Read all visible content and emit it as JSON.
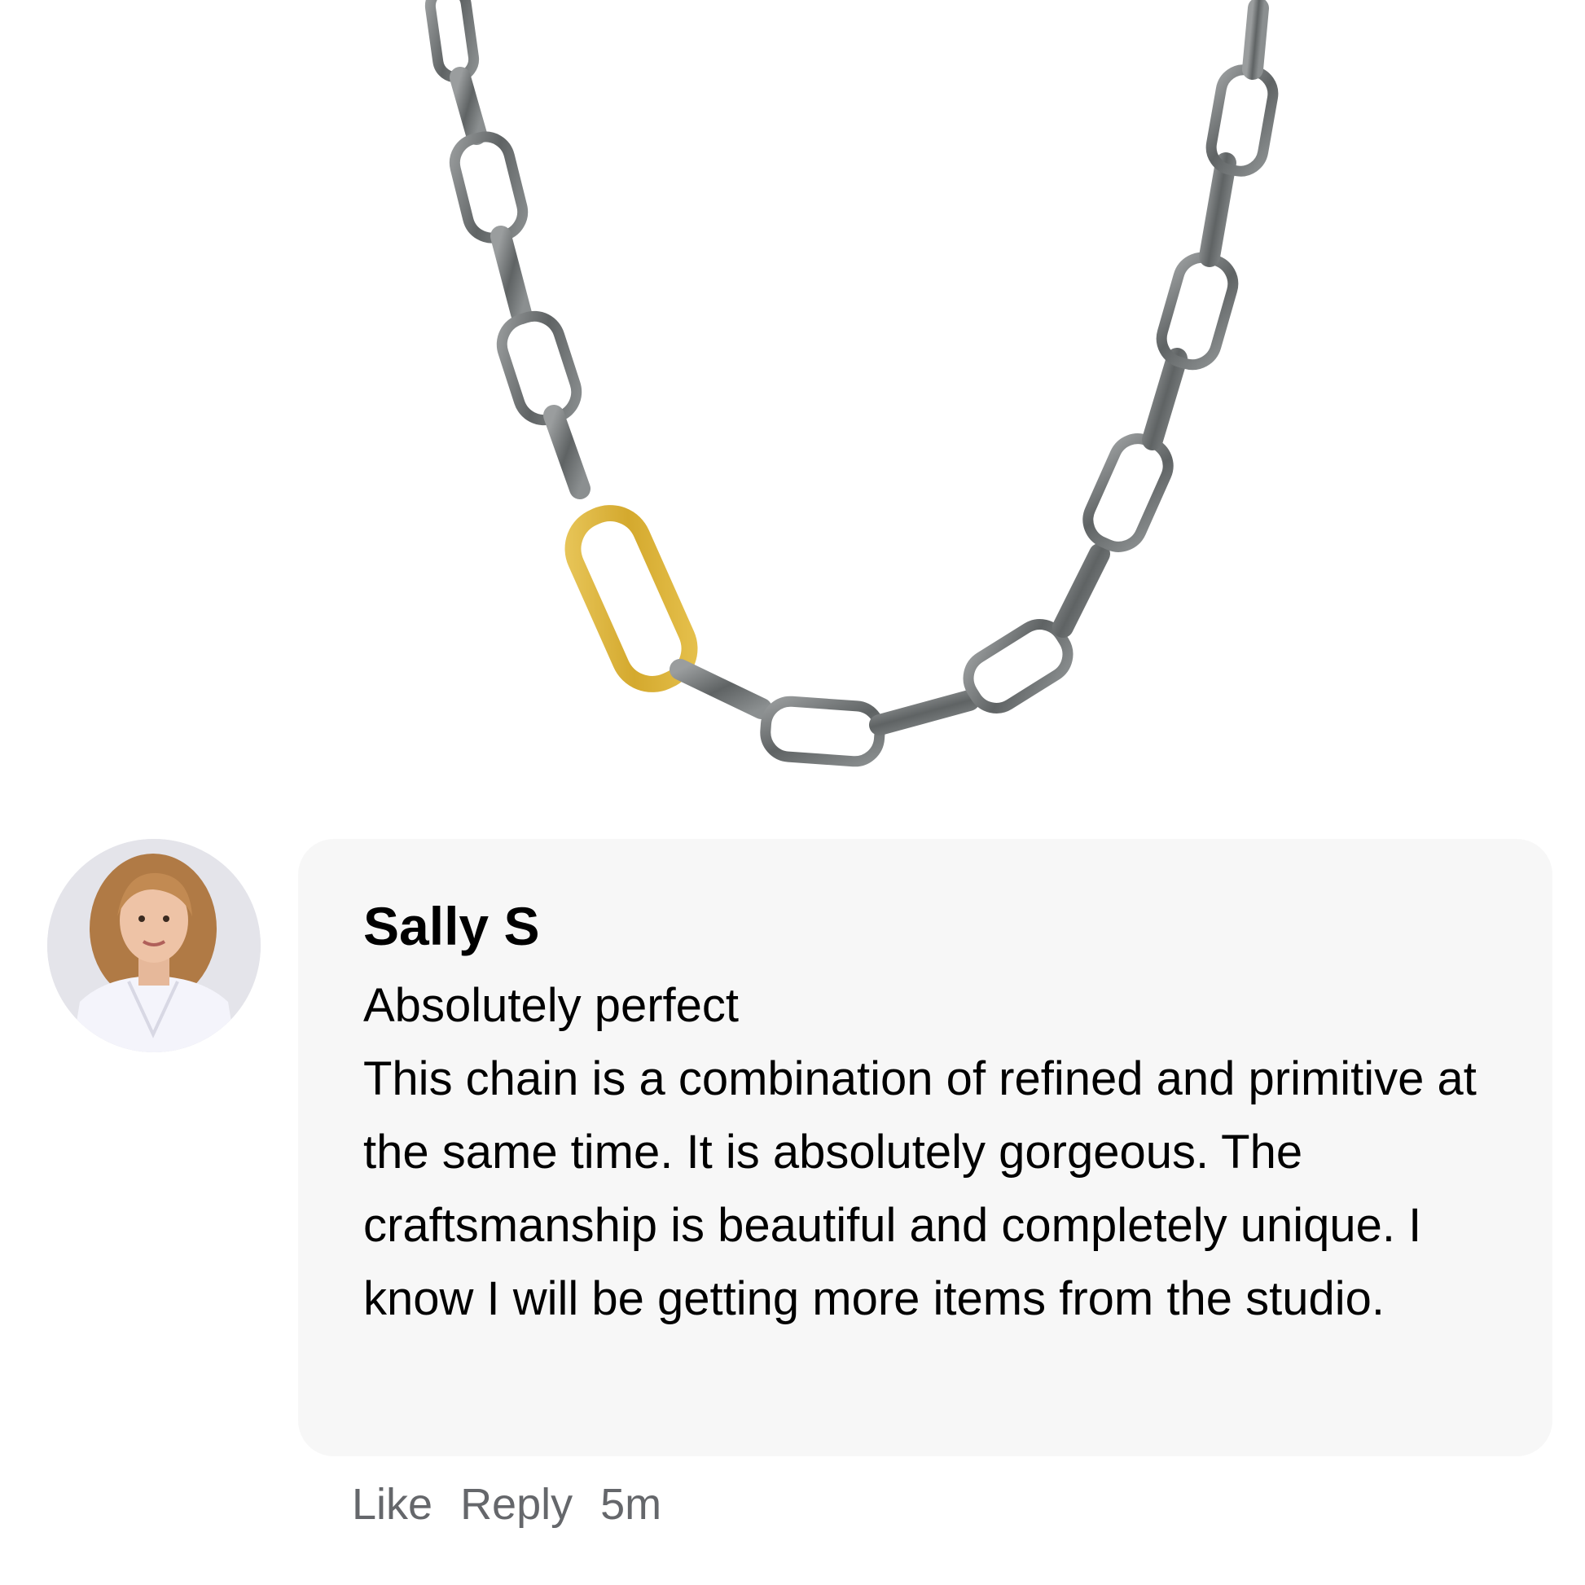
{
  "comment": {
    "author": "Sally S",
    "title": "Absolutely perfect",
    "body": "This chain is a combination of refined and primitive at the same time. It is absolutely gorgeous. The craftsmanship is beautiful and completely unique. I know I will be getting more items from the studio.",
    "actions": {
      "like_label": "Like",
      "reply_label": "Reply",
      "timestamp": "5m"
    }
  },
  "colors": {
    "bubble_background": "#f7f7f7",
    "action_text": "#65676b",
    "chain_silver": "#6e7273",
    "chain_gold": "#d9b23a"
  }
}
